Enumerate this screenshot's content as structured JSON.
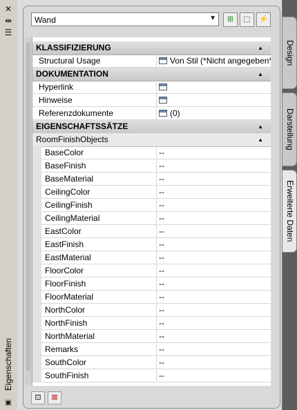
{
  "palette_title": "Eigenschaften",
  "object_selector": {
    "value": "Wand"
  },
  "sections": [
    {
      "header": "KLASSIFIZIERUNG",
      "rows": [
        {
          "label": "Structural Usage",
          "value": "Von Stil (*Nicht angegeben*)"
        }
      ]
    },
    {
      "header": "DOKUMENTATION",
      "rows": [
        {
          "label": "Hyperlink",
          "value": ""
        },
        {
          "label": "Hinweise",
          "value": ""
        },
        {
          "label": "Referenzdokumente",
          "value": "(0)"
        }
      ]
    },
    {
      "header": "EIGENSCHAFTSSÄTZE",
      "subheader": "RoomFinishObjects",
      "rows": [
        {
          "label": "BaseColor",
          "value": "--"
        },
        {
          "label": "BaseFinish",
          "value": "--"
        },
        {
          "label": "BaseMaterial",
          "value": "--"
        },
        {
          "label": "CeilingColor",
          "value": "--"
        },
        {
          "label": "CeilingFinish",
          "value": "--"
        },
        {
          "label": "CeilingMaterial",
          "value": "--"
        },
        {
          "label": "EastColor",
          "value": "--"
        },
        {
          "label": "EastFinish",
          "value": "--"
        },
        {
          "label": "EastMaterial",
          "value": "--"
        },
        {
          "label": "FloorColor",
          "value": "--"
        },
        {
          "label": "FloorFinish",
          "value": "--"
        },
        {
          "label": "FloorMaterial",
          "value": "--"
        },
        {
          "label": "NorthColor",
          "value": "--"
        },
        {
          "label": "NorthFinish",
          "value": "--"
        },
        {
          "label": "NorthMaterial",
          "value": "--"
        },
        {
          "label": "Remarks",
          "value": "--"
        },
        {
          "label": "SouthColor",
          "value": "--"
        },
        {
          "label": "SouthFinish",
          "value": "--"
        }
      ]
    }
  ],
  "tabs": [
    {
      "label": "Design"
    },
    {
      "label": "Darstellung"
    },
    {
      "label": "Erweiterte Daten"
    }
  ]
}
